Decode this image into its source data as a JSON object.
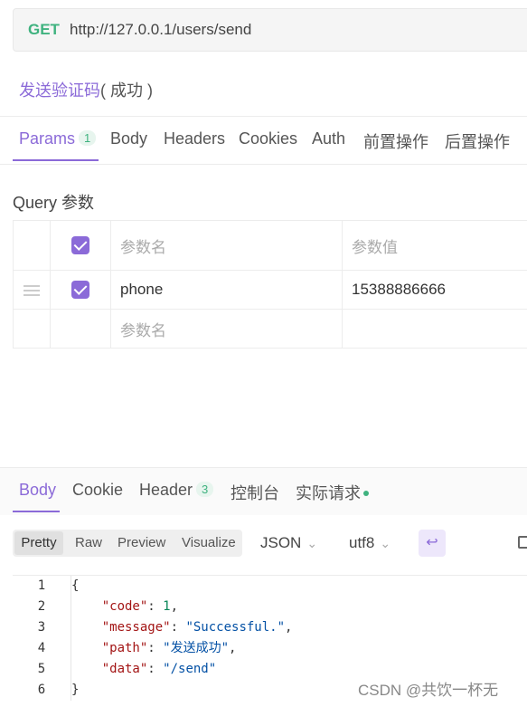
{
  "request": {
    "method": "GET",
    "url": "http://127.0.0.1/users/send",
    "name": "发送验证码",
    "status": "( 成功 )"
  },
  "tabs": [
    {
      "label": "Params",
      "badge": "1"
    },
    {
      "label": "Body"
    },
    {
      "label": "Headers"
    },
    {
      "label": "Cookies"
    },
    {
      "label": "Auth"
    },
    {
      "label": "前置操作"
    },
    {
      "label": "后置操作"
    }
  ],
  "query": {
    "title": "Query 参数",
    "header": {
      "name_placeholder": "参数名",
      "value_placeholder": "参数值"
    },
    "rows": [
      {
        "name": "phone",
        "value": "15388886666",
        "checked": true
      }
    ],
    "new_row_placeholder": "参数名"
  },
  "response": {
    "tabs": [
      {
        "label": "Body"
      },
      {
        "label": "Cookie"
      },
      {
        "label": "Header",
        "badge": "3"
      },
      {
        "label": "控制台"
      },
      {
        "label": "实际请求"
      }
    ],
    "formats": [
      "Pretty",
      "Raw",
      "Preview",
      "Visualize"
    ],
    "active_format": "Pretty",
    "language": "JSON",
    "encoding": "utf8",
    "line_numbers": [
      "1",
      "2",
      "3",
      "4",
      "5",
      "6"
    ],
    "body": {
      "code": "1",
      "message": "Successful.",
      "path": "发送成功",
      "data": "/send"
    }
  },
  "watermark": "CSDN @共饮一杯无",
  "colors": {
    "accent": "#8b6ad8",
    "method_get": "#3fb27f"
  },
  "icons": [
    "drag-handle-icon",
    "checkbox-icon",
    "chevron-down-icon",
    "wrap-lines-icon",
    "open-external-icon"
  ]
}
